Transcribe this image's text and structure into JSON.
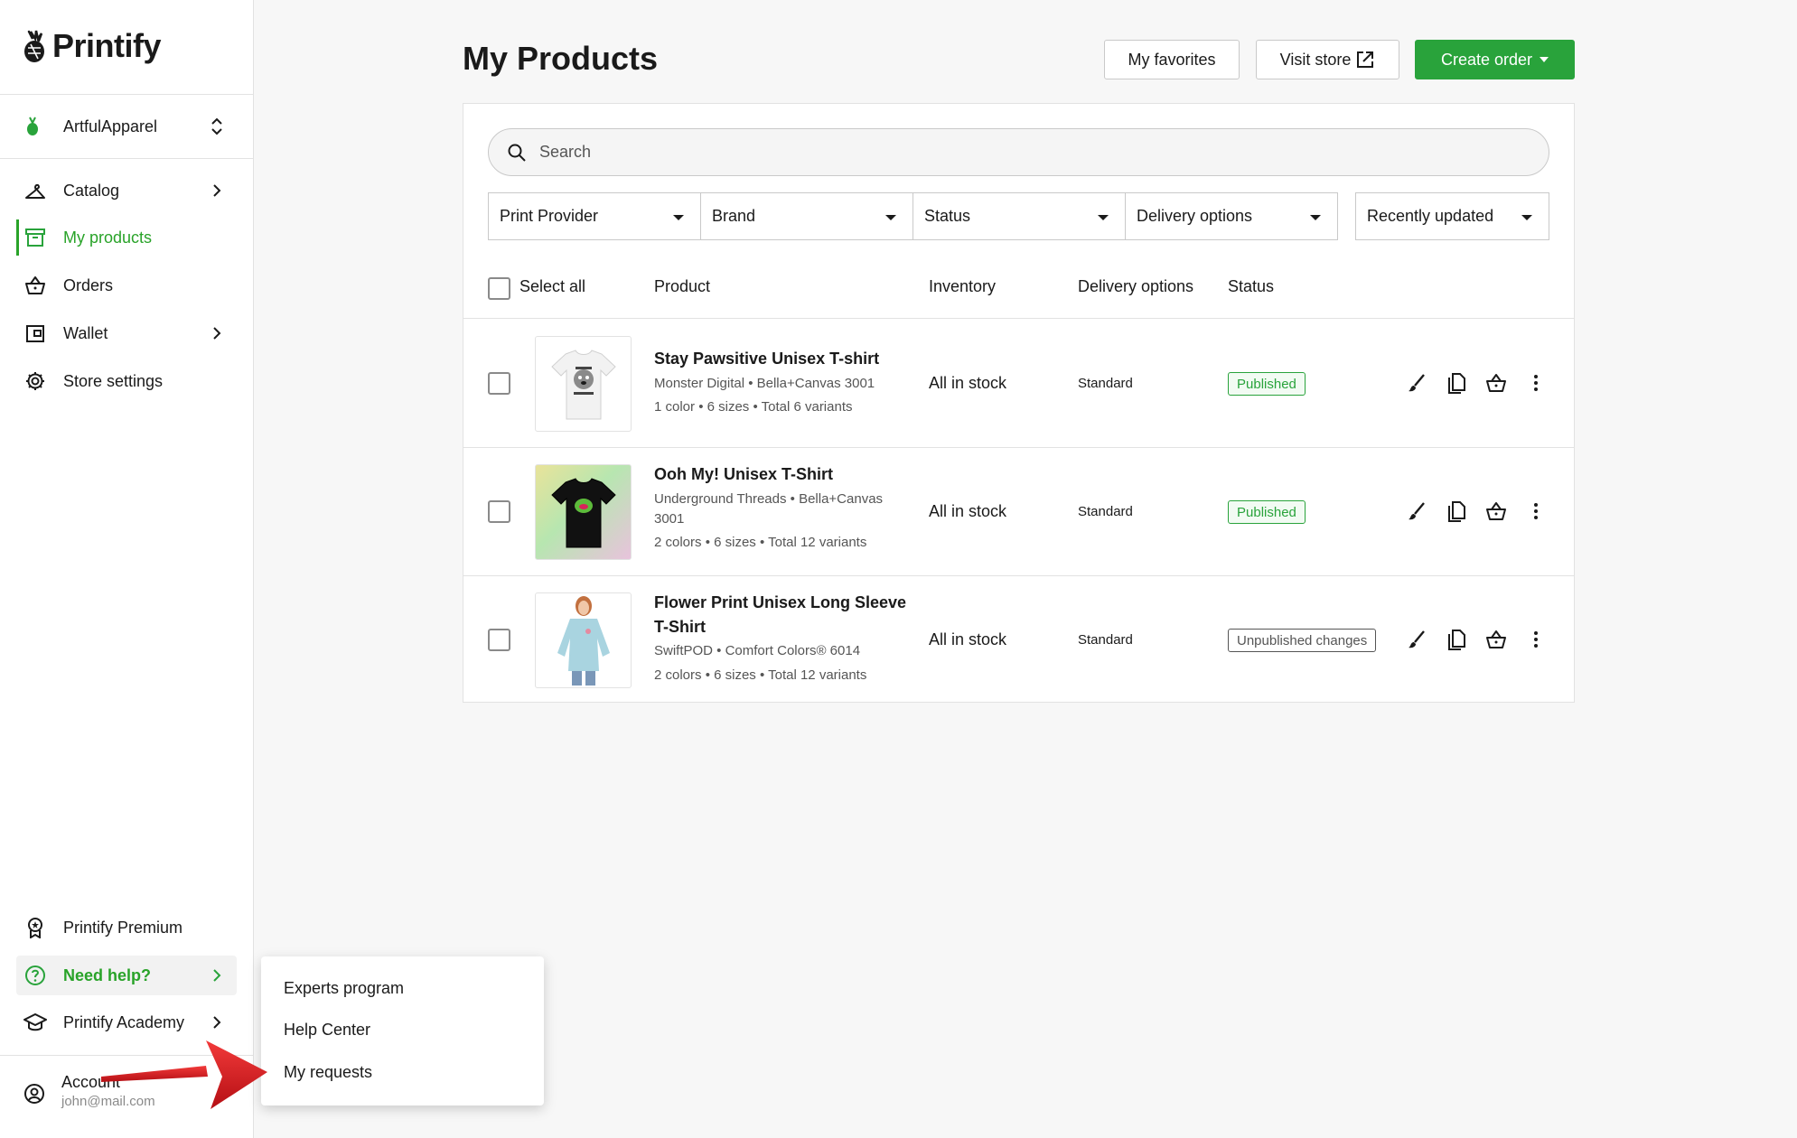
{
  "sidebar": {
    "logo_text": "Printify",
    "store_name": "ArtfulApparel",
    "nav": {
      "catalog": "Catalog",
      "my_products": "My products",
      "orders": "Orders",
      "wallet": "Wallet",
      "store_settings": "Store settings"
    },
    "bottom": {
      "premium": "Printify Premium",
      "need_help": "Need help?",
      "academy": "Printify Academy"
    },
    "account": {
      "name": "Account",
      "email": "john@mail.com"
    }
  },
  "header": {
    "title": "My Products",
    "favorites": "My favorites",
    "visit_store": "Visit store",
    "create_order": "Create order"
  },
  "search": {
    "placeholder": "Search"
  },
  "filters": [
    "Print Provider",
    "Brand",
    "Status",
    "Delivery options"
  ],
  "sort": "Recently updated",
  "table": {
    "select_all": "Select all",
    "columns": {
      "product": "Product",
      "inventory": "Inventory",
      "delivery": "Delivery options",
      "status": "Status"
    },
    "rows": [
      {
        "name": "Stay Pawsitive Unisex T-shirt",
        "provider": "Monster Digital • Bella+Canvas 3001",
        "variants": "1 color • 6 sizes • Total 6 variants",
        "inventory": "All in stock",
        "delivery": "Standard",
        "status": "Published"
      },
      {
        "name": "Ooh My! Unisex T-Shirt",
        "provider": "Underground Threads • Bella+Canvas 3001",
        "variants": "2 colors • 6 sizes • Total 12 variants",
        "inventory": "All in stock",
        "delivery": "Standard",
        "status": "Published"
      },
      {
        "name": "Flower Print Unisex Long Sleeve T-Shirt",
        "provider": "SwiftPOD • Comfort Colors® 6014",
        "variants": "2 colors • 6 sizes • Total 12 variants",
        "inventory": "All in stock",
        "delivery": "Standard",
        "status": "Unpublished changes"
      }
    ]
  },
  "help_menu": [
    "Experts program",
    "Help Center",
    "My requests"
  ],
  "colors": {
    "accent": "#29a33b",
    "annotation_arrow": "#d8161b"
  }
}
